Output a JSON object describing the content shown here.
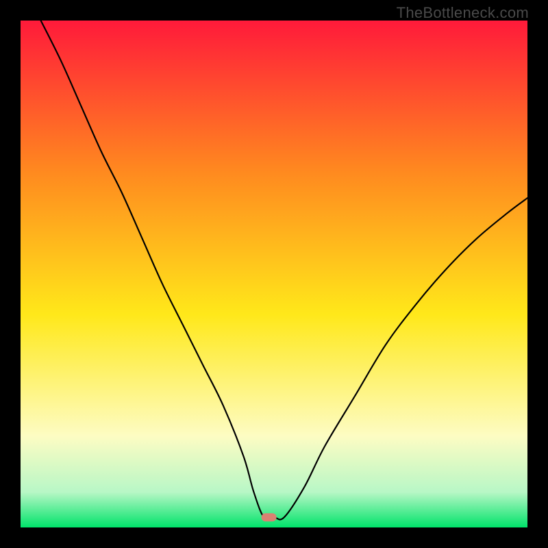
{
  "watermark": "TheBottleneck.com",
  "colors": {
    "frame": "#000000",
    "gradient_top": "#ff1a3a",
    "gradient_upper_mid": "#ff8a1f",
    "gradient_mid": "#ffe81a",
    "gradient_lower_mid": "#fdfcc3",
    "gradient_near_bottom": "#b8f7c6",
    "gradient_bottom": "#00e36a",
    "marker": "#d98272",
    "curve": "#000000"
  },
  "chart_data": {
    "type": "line",
    "title": "",
    "xlabel": "",
    "ylabel": "",
    "xlim": [
      0,
      100
    ],
    "ylim": [
      0,
      100
    ],
    "marker": {
      "x": 49,
      "y": 2
    },
    "series": [
      {
        "name": "bottleneck-curve",
        "x": [
          4,
          8,
          12,
          16,
          20,
          24,
          28,
          32,
          36,
          40,
          44,
          46,
          48,
          50,
          52,
          56,
          60,
          66,
          72,
          78,
          84,
          90,
          96,
          100
        ],
        "y": [
          100,
          92,
          83,
          74,
          66,
          57,
          48,
          40,
          32,
          24,
          14,
          7,
          2,
          2,
          2,
          8,
          16,
          26,
          36,
          44,
          51,
          57,
          62,
          65
        ]
      }
    ]
  }
}
